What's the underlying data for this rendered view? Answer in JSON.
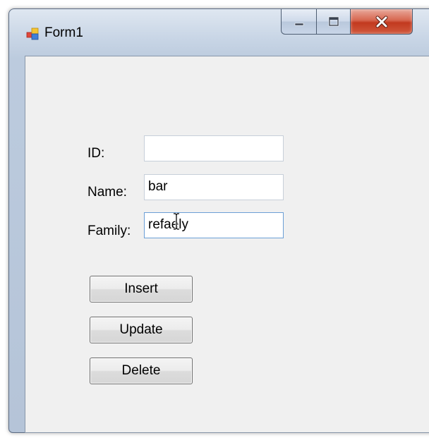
{
  "window": {
    "title": "Form1",
    "icon": "winforms-app-icon",
    "caption_buttons": [
      "minimize-icon",
      "maximize-icon",
      "close-icon"
    ]
  },
  "form": {
    "fields": [
      {
        "label": "ID:",
        "value": "",
        "focused": false
      },
      {
        "label": "Name:",
        "value": "bar",
        "focused": false
      },
      {
        "label": "Family:",
        "value": "refaely",
        "focused": true
      }
    ],
    "buttons": {
      "insert": "Insert",
      "update": "Update",
      "delete": "Delete"
    }
  },
  "cursor": "text-ibeam-cursor",
  "colors": {
    "client_bg": "#f0f0f0",
    "focus_border": "#6b9fd6",
    "close_red": "#c2391f"
  }
}
